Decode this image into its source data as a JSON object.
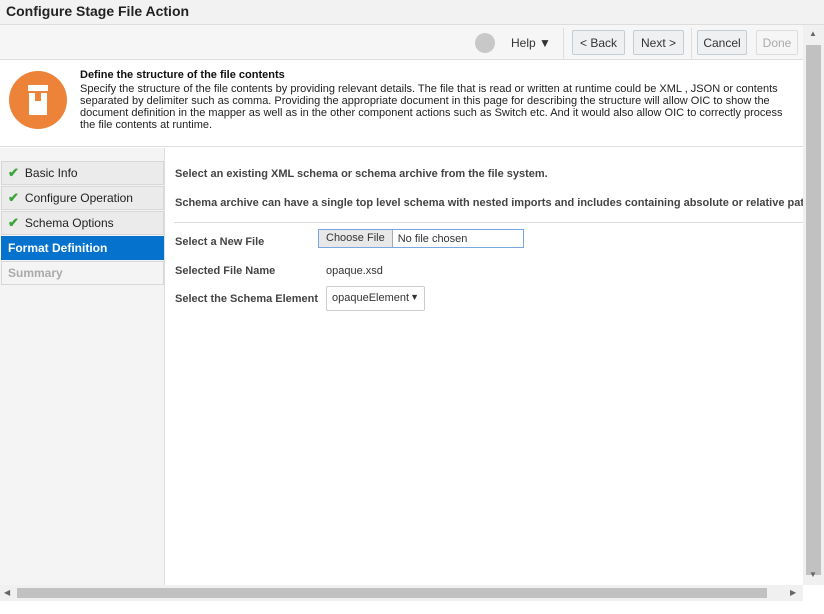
{
  "window": {
    "title": "Configure Stage File Action"
  },
  "toolbar": {
    "help": "Help ▼",
    "back": "< Back",
    "next": "Next >",
    "cancel": "Cancel",
    "done": "Done"
  },
  "header": {
    "title": "Define the structure of the file contents",
    "description": "Specify the structure of the file contents by providing relevant details. The file that is read or written at runtime could be XML , JSON or contents separated by delimiter such as comma. Providing the appropriate document in this page for describing the structure will allow OIC to show the document definition in the mapper as well as in the other component actions such as Switch etc. And it would also allow OIC to correctly process the file contents at runtime.",
    "icon": "stage-file-icon",
    "icon_color": "#ec8339"
  },
  "sidebar": {
    "steps": [
      {
        "label": "Basic Info",
        "status": "complete"
      },
      {
        "label": "Configure Operation",
        "status": "complete"
      },
      {
        "label": "Schema Options",
        "status": "complete"
      },
      {
        "label": "Format Definition",
        "status": "active"
      },
      {
        "label": "Summary",
        "status": "disabled"
      }
    ]
  },
  "main": {
    "intro": "Select an existing XML schema or schema archive from the file system.",
    "archive_note": "Schema archive can have a single top level schema with nested imports and includes containing absolute or relative paths",
    "new_file_label": "Select a New File",
    "choose_file": "Choose File",
    "no_file": "No file chosen",
    "selected_file_label": "Selected File Name",
    "selected_file": "opaque.xsd",
    "schema_element_label": "Select the Schema Element",
    "schema_element": "opaqueElement"
  }
}
